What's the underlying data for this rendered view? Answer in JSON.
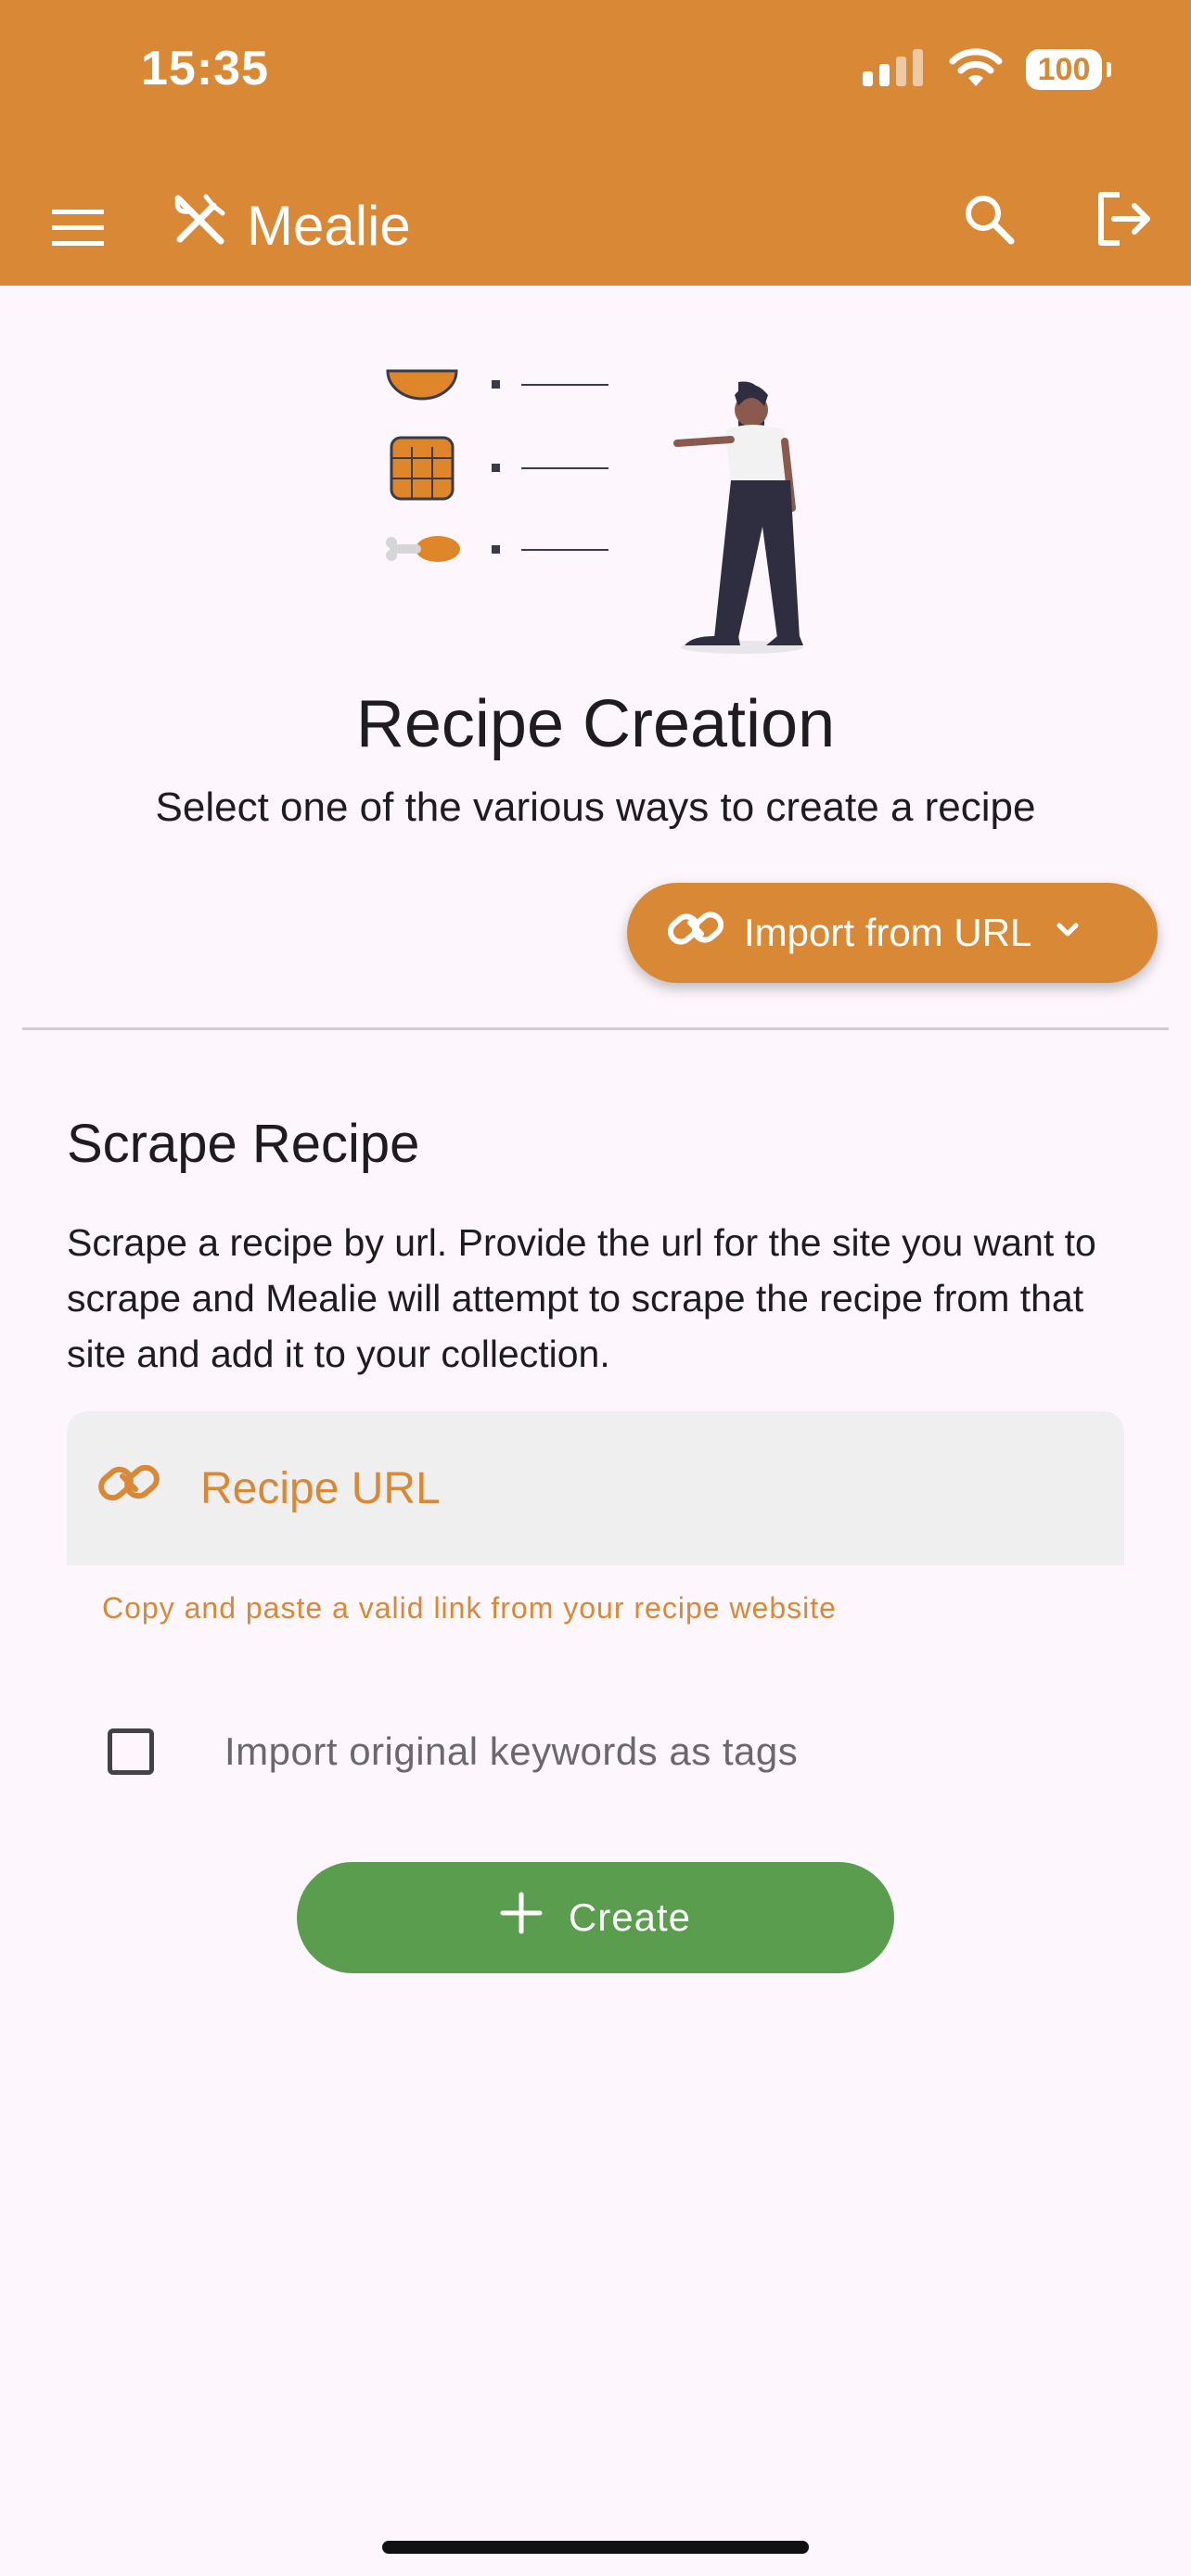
{
  "status_bar": {
    "time": "15:35",
    "battery": "100"
  },
  "app_bar": {
    "title": "Mealie",
    "icons": {
      "menu": "menu-icon",
      "logo": "fork-knife-icon",
      "search": "search-icon",
      "logout": "logout-icon"
    }
  },
  "page": {
    "title": "Recipe Creation",
    "subtitle": "Select one of the various ways to create a recipe",
    "import_button_label": "Import from URL"
  },
  "scrape": {
    "title": "Scrape Recipe",
    "description": "Scrape a recipe by url. Provide the url for the site you want to scrape and Mealie will attempt to scrape the recipe from that site and add it to your collection.",
    "url_placeholder": "Recipe URL",
    "url_value": "",
    "url_hint": "Copy and paste a valid link from your recipe website",
    "checkbox_label": "Import original keywords as tags",
    "checkbox_checked": false,
    "create_button_label": "Create"
  },
  "colors": {
    "primary": "#d98936",
    "success": "#5b9d4f",
    "background": "#fdf7fd",
    "field_background": "#efeff0"
  }
}
